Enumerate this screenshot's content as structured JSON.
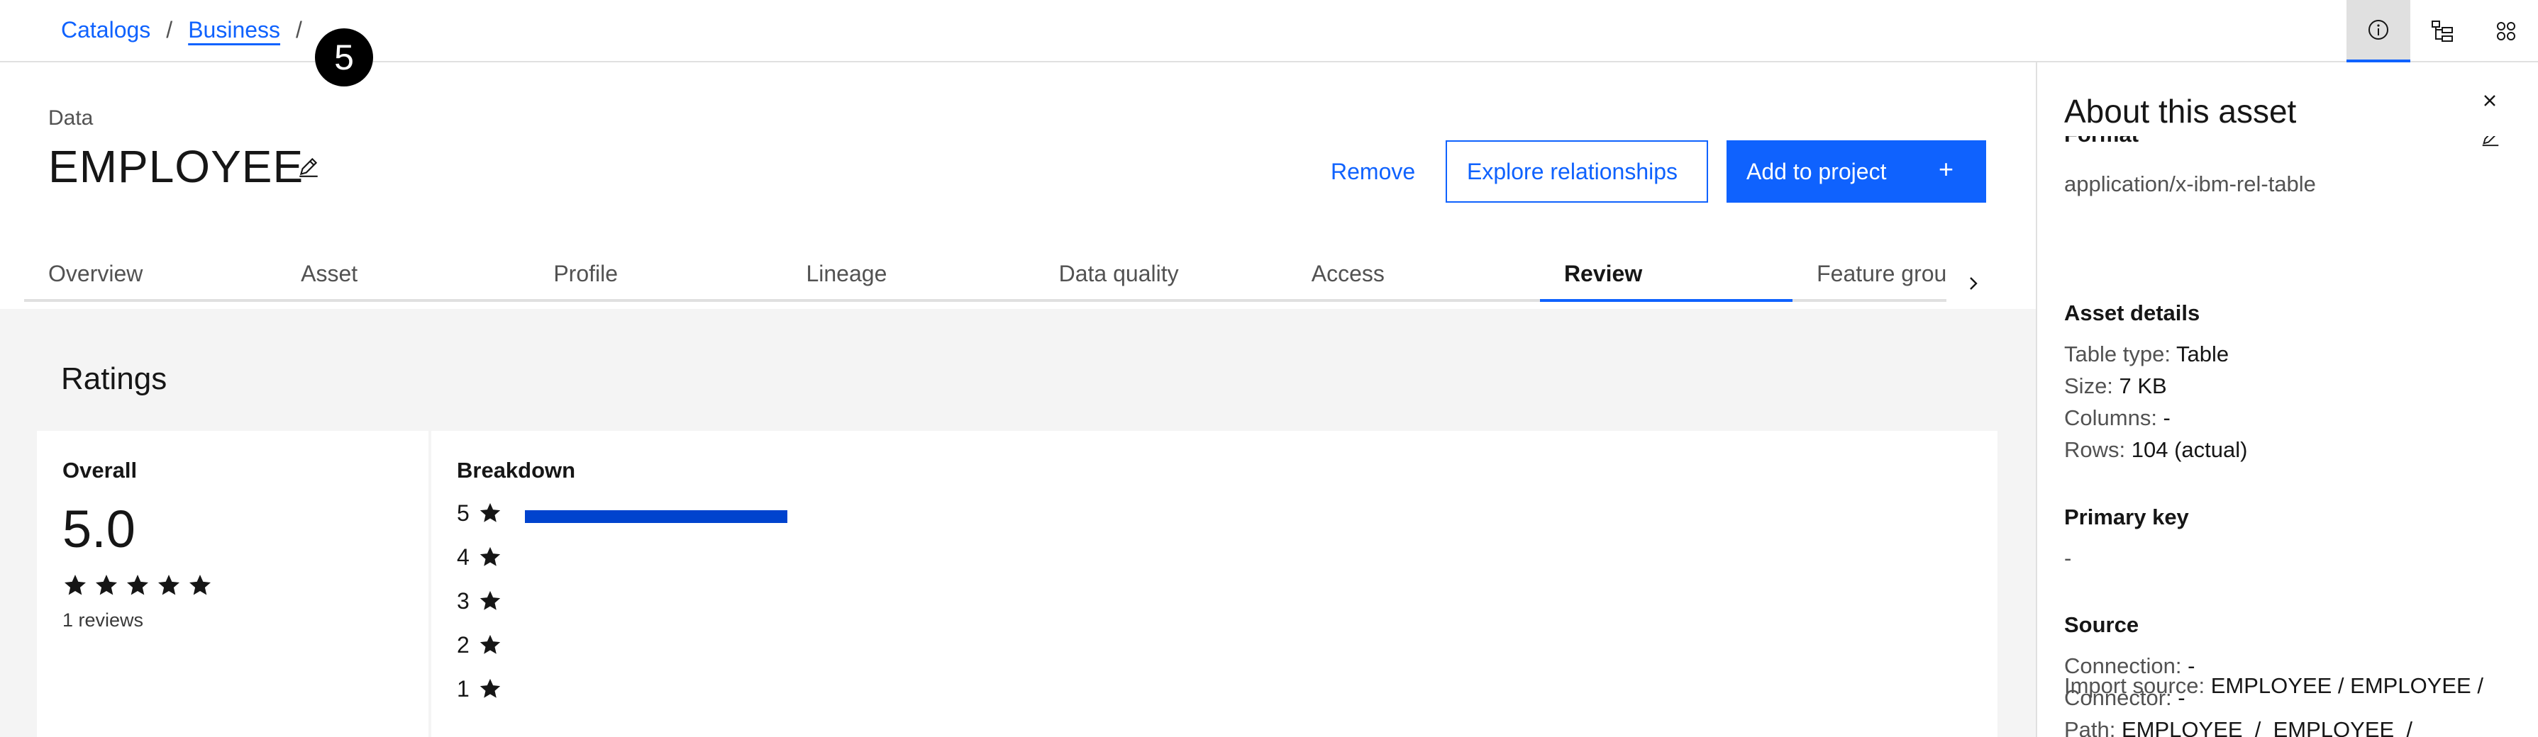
{
  "breadcrumb": {
    "items": [
      "Catalogs",
      "Business"
    ],
    "separator": "/"
  },
  "step_badge": "5",
  "top_icons": [
    "info-icon",
    "tree-view-icon",
    "apps-icon"
  ],
  "asset": {
    "type_label": "Data",
    "title": "EMPLOYEE"
  },
  "actions": {
    "remove": "Remove",
    "explore": "Explore relationships",
    "add": "Add to project",
    "add_icon": "+"
  },
  "tabs": [
    "Overview",
    "Asset",
    "Profile",
    "Lineage",
    "Data quality",
    "Access",
    "Review",
    "Feature grou"
  ],
  "active_tab": "Review",
  "ratings": {
    "title": "Ratings",
    "overall_label": "Overall",
    "overall_value": "5.0",
    "overall_stars": 5,
    "review_count": "1 reviews",
    "breakdown_label": "Breakdown",
    "breakdown": [
      {
        "stars": "5",
        "fraction": 1.0
      },
      {
        "stars": "4",
        "fraction": 0
      },
      {
        "stars": "3",
        "fraction": 0
      },
      {
        "stars": "2",
        "fraction": 0
      },
      {
        "stars": "1",
        "fraction": 0
      }
    ]
  },
  "side_panel": {
    "title": "About this asset",
    "format_heading": "Format",
    "format_value": "application/x-ibm-rel-table",
    "asset_details_heading": "Asset details",
    "table_type_label": "Table type: ",
    "table_type_value": "Table",
    "size_label": "Size: ",
    "size_value": "7 KB",
    "columns_label": "Columns: ",
    "columns_value": "-",
    "rows_label": "Rows: ",
    "rows_value": "104 (actual)",
    "primary_key_heading": "Primary key",
    "primary_key_value": "-",
    "source_heading": "Source",
    "connection_label": "Connection: ",
    "connection_value": "-",
    "connector_label": "Connector: ",
    "connector_value": "-",
    "path_label": "Path: ",
    "path_value": "EMPLOYEE  /  EMPLOYEE  /",
    "import_label": "Import source: ",
    "import_value": "EMPLOYEE / EMPLOYEE /"
  },
  "colors": {
    "accent": "#0f62fe",
    "bar": "#0043ce",
    "background": "#f4f4f4"
  }
}
